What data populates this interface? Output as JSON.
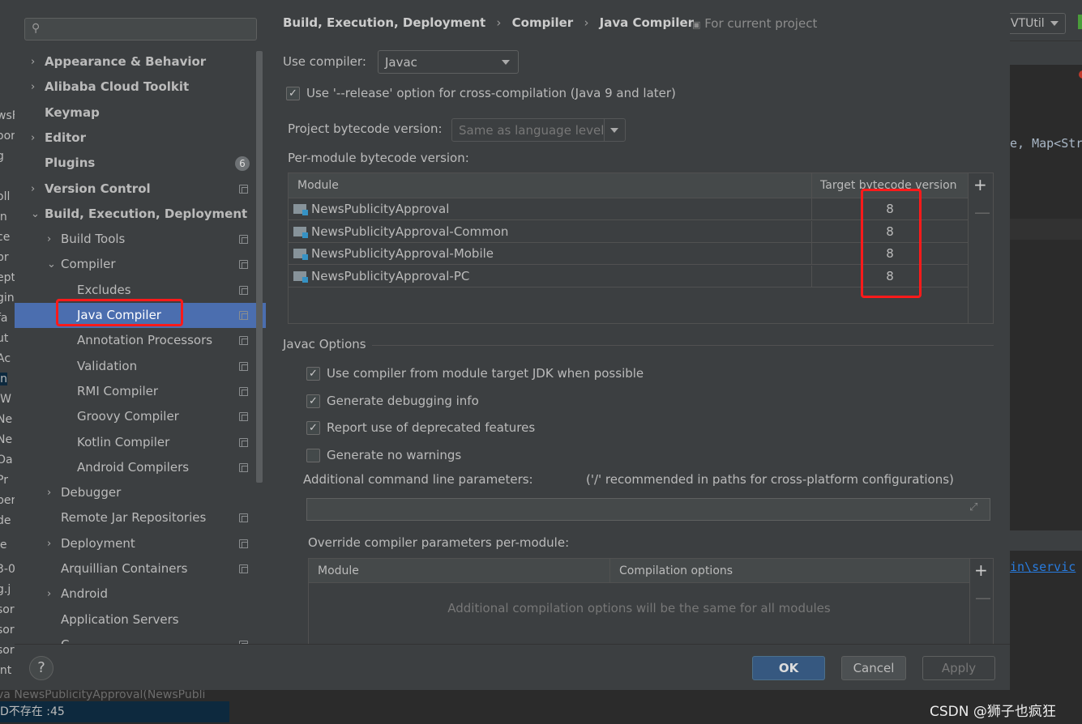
{
  "background_ide": {
    "left_fragments": [
      "wsF",
      "oor",
      "g",
      "oll",
      "in",
      "ce",
      "pr",
      "ept",
      "gin",
      "fa",
      "ut",
      "Ac",
      "In",
      "IW",
      "Ne",
      "Ne",
      "Oa",
      "Pr",
      "per",
      "de",
      "le",
      "3-0",
      "g.j",
      "sor",
      "sor",
      "sor",
      "int"
    ],
    "status_line": "va NewsPublicityApproval(NewsPubli",
    "status_error": "D不存在 :45",
    "run_config": "VTUtil",
    "code_snippet": "e, Map<Str",
    "link_text": "in\\servic",
    "watermark": "CSDN @狮子也疯狂"
  },
  "sidebar": {
    "search_placeholder": "",
    "items": [
      {
        "label": "Appearance & Behavior",
        "level": 0,
        "chevron": ">",
        "bold": true
      },
      {
        "label": "Alibaba Cloud Toolkit",
        "level": 0,
        "chevron": ">",
        "bold": true
      },
      {
        "label": "Keymap",
        "level": 0,
        "bold": true
      },
      {
        "label": "Editor",
        "level": 0,
        "chevron": ">",
        "bold": true
      },
      {
        "label": "Plugins",
        "level": 0,
        "bold": true,
        "badge": "6"
      },
      {
        "label": "Version Control",
        "level": 0,
        "chevron": ">",
        "bold": true,
        "project": true
      },
      {
        "label": "Build, Execution, Deployment",
        "level": 0,
        "chevron": "v",
        "bold": true
      },
      {
        "label": "Build Tools",
        "level": 1,
        "chevron": ">",
        "project": true
      },
      {
        "label": "Compiler",
        "level": 1,
        "chevron": "v",
        "project": true
      },
      {
        "label": "Excludes",
        "level": 2,
        "project": true
      },
      {
        "label": "Java Compiler",
        "level": 2,
        "project": true,
        "selected": true
      },
      {
        "label": "Annotation Processors",
        "level": 2,
        "project": true
      },
      {
        "label": "Validation",
        "level": 2,
        "project": true
      },
      {
        "label": "RMI Compiler",
        "level": 2,
        "project": true
      },
      {
        "label": "Groovy Compiler",
        "level": 2,
        "project": true
      },
      {
        "label": "Kotlin Compiler",
        "level": 2,
        "project": true
      },
      {
        "label": "Android Compilers",
        "level": 2,
        "project": true
      },
      {
        "label": "Debugger",
        "level": 1,
        "chevron": ">"
      },
      {
        "label": "Remote Jar Repositories",
        "level": 1,
        "project": true
      },
      {
        "label": "Deployment",
        "level": 1,
        "chevron": ">",
        "project": true
      },
      {
        "label": "Arquillian Containers",
        "level": 1,
        "project": true
      },
      {
        "label": "Android",
        "level": 1,
        "chevron": ">"
      },
      {
        "label": "Application Servers",
        "level": 1
      },
      {
        "label": "C...",
        "level": 1,
        "project": true
      }
    ]
  },
  "breadcrumb": {
    "items": [
      "Build, Execution, Deployment",
      "Compiler",
      "Java Compiler"
    ],
    "scope": "For current project"
  },
  "use_compiler": {
    "label": "Use compiler:",
    "value": "Javac"
  },
  "release_option": {
    "label": "Use '--release' option for cross-compilation (Java 9 and later)",
    "checked": true
  },
  "project_bytecode": {
    "label": "Project bytecode version:",
    "value": "Same as language level"
  },
  "per_module": {
    "label": "Per-module bytecode version:",
    "columns": [
      "Module",
      "Target bytecode version"
    ],
    "rows": [
      {
        "module": "NewsPublicityApproval",
        "version": "8"
      },
      {
        "module": "NewsPublicityApproval-Common",
        "version": "8"
      },
      {
        "module": "NewsPublicityApproval-Mobile",
        "version": "8"
      },
      {
        "module": "NewsPublicityApproval-PC",
        "version": "8"
      }
    ]
  },
  "javac_options": {
    "title": "Javac Options",
    "checkboxes": [
      {
        "label": "Use compiler from module target JDK when possible",
        "checked": true
      },
      {
        "label": "Generate debugging info",
        "checked": true
      },
      {
        "label": "Report use of deprecated features",
        "checked": true
      },
      {
        "label": "Generate no warnings",
        "checked": false
      }
    ],
    "additional_label": "Additional command line parameters:",
    "additional_hint": "('/' recommended in paths for cross-platform configurations)",
    "additional_value": "",
    "override_label": "Override compiler parameters per-module:",
    "override_columns": [
      "Module",
      "Compilation options"
    ],
    "override_empty": "Additional compilation options will be the same for all modules"
  },
  "buttons": {
    "ok": "OK",
    "cancel": "Cancel",
    "apply": "Apply",
    "help": "?"
  },
  "colors": {
    "selection": "#4b6eaf",
    "highlight_box": "#ff1a1a",
    "ok_button": "#365880"
  }
}
